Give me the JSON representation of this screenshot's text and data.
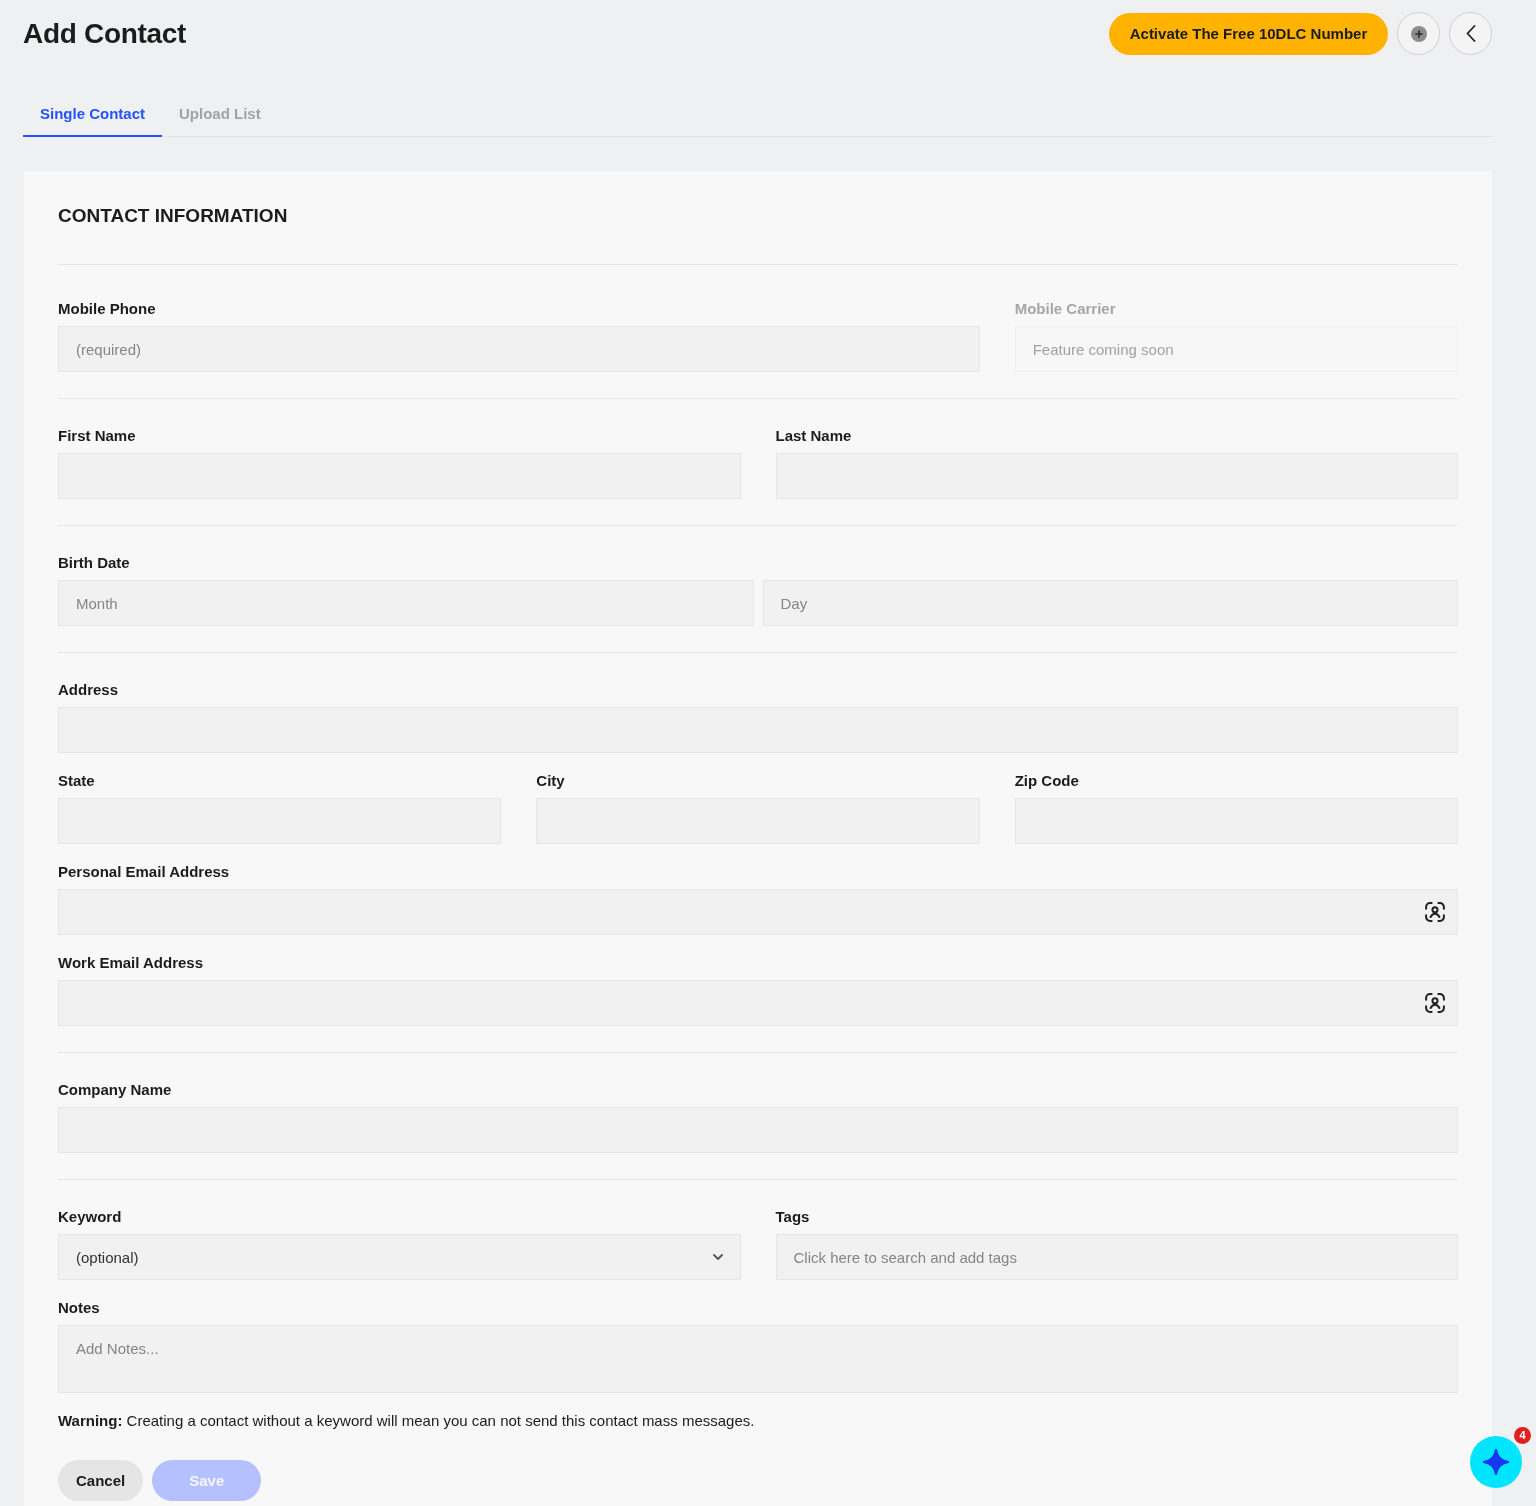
{
  "header": {
    "title": "Add Contact",
    "activate_button": "Activate The Free 10DLC Number"
  },
  "tabs": [
    {
      "label": "Single Contact",
      "selected": true
    },
    {
      "label": "Upload List",
      "selected": false
    }
  ],
  "form": {
    "heading": "CONTACT INFORMATION",
    "sections": [
      {
        "rows": [
          {
            "groups": [
              {
                "label": "Mobile Phone",
                "disabled": false,
                "fields": [
                  {
                    "kind": "text",
                    "placeholder": "(required)"
                  }
                ]
              },
              {
                "label": "Mobile Carrier",
                "disabled": true,
                "fields": [
                  {
                    "kind": "text",
                    "placeholder": "Feature coming soon"
                  }
                ]
              }
            ]
          }
        ]
      },
      {
        "rows": [
          {
            "groups": [
              {
                "label": "First Name",
                "disabled": false,
                "fields": [
                  {
                    "kind": "text"
                  }
                ]
              },
              {
                "label": "Last Name",
                "disabled": false,
                "fields": [
                  {
                    "kind": "text"
                  }
                ]
              }
            ]
          }
        ]
      },
      {
        "rows": [
          {
            "groups": [
              {
                "label": "Birth Date",
                "disabled": false,
                "fields": [
                  {
                    "kind": "text",
                    "placeholder": "Month"
                  },
                  {
                    "kind": "text",
                    "placeholder": "Day"
                  }
                ]
              }
            ]
          }
        ]
      },
      {
        "rows": [
          {
            "groups": [
              {
                "label": "Address",
                "disabled": false,
                "fields": [
                  {
                    "kind": "text"
                  }
                ]
              }
            ]
          },
          {
            "groups": [
              {
                "label": "State",
                "disabled": false,
                "fields": [
                  {
                    "kind": "text"
                  }
                ]
              },
              {
                "label": "City",
                "disabled": false,
                "fields": [
                  {
                    "kind": "text"
                  }
                ]
              },
              {
                "label": "Zip Code",
                "disabled": false,
                "fields": [
                  {
                    "kind": "text"
                  }
                ]
              }
            ]
          },
          {
            "groups": [
              {
                "label": "Personal Email Address",
                "disabled": false,
                "fields": [
                  {
                    "kind": "email"
                  }
                ]
              }
            ]
          },
          {
            "groups": [
              {
                "label": "Work Email Address",
                "disabled": false,
                "fields": [
                  {
                    "kind": "email"
                  }
                ]
              }
            ]
          }
        ]
      },
      {
        "rows": [
          {
            "groups": [
              {
                "label": "Company Name",
                "disabled": false,
                "fields": [
                  {
                    "kind": "text"
                  }
                ]
              }
            ]
          }
        ]
      },
      {
        "rows": [
          {
            "groups": [
              {
                "label": "Keyword",
                "disabled": false,
                "fields": [
                  {
                    "kind": "select",
                    "value": "(optional)"
                  }
                ]
              },
              {
                "label": "Tags",
                "disabled": false,
                "fields": [
                  {
                    "kind": "text",
                    "placeholder": "Click here to search and add tags"
                  }
                ]
              }
            ]
          },
          {
            "groups": [
              {
                "label": "Notes",
                "disabled": false,
                "fields": [
                  {
                    "kind": "textarea",
                    "placeholder": "Add Notes..."
                  }
                ]
              }
            ]
          }
        ]
      }
    ],
    "warning": "**Warning:** Creating a contact without a keyword will mean you can not send this contact mass messages.",
    "buttons": [
      {
        "label": "Cancel",
        "kind": "secondary",
        "disabled": false
      },
      {
        "label": "Save",
        "kind": "primary",
        "disabled": true
      }
    ]
  },
  "chat_widget": {
    "badge": "4"
  }
}
